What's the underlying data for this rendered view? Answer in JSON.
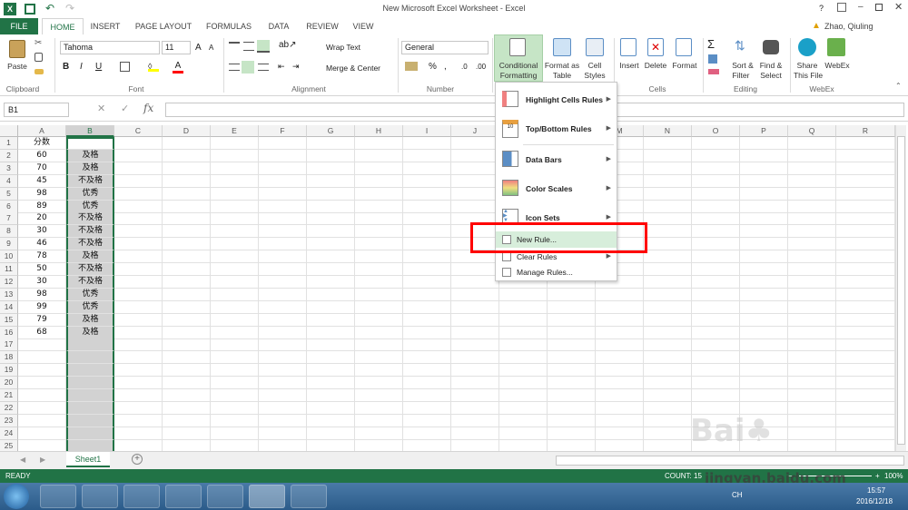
{
  "window": {
    "title": "New Microsoft Excel Worksheet - Excel",
    "user": "Zhao, Qiuling",
    "help": "?"
  },
  "tabs": [
    "FILE",
    "HOME",
    "INSERT",
    "PAGE LAYOUT",
    "FORMULAS",
    "DATA",
    "REVIEW",
    "VIEW"
  ],
  "ribbon": {
    "paste": "Paste",
    "clipboard": "Clipboard",
    "font_name": "Tahoma",
    "font_size": "11",
    "font": "Font",
    "bold": "B",
    "italic": "I",
    "underline": "U",
    "wrap_text": "Wrap Text",
    "merge_center": "Merge & Center",
    "alignment": "Alignment",
    "number_format": "General",
    "number": "Number",
    "percent": "%",
    "cond_fmt_1": "Conditional",
    "cond_fmt_2": "Formatting",
    "format_table_1": "Format as",
    "format_table_2": "Table",
    "cell_styles_1": "Cell",
    "cell_styles_2": "Styles",
    "insert": "Insert",
    "delete": "Delete",
    "format": "Format",
    "cells": "Cells",
    "sort_1": "Sort &",
    "sort_2": "Filter",
    "find_1": "Find &",
    "find_2": "Select",
    "editing": "Editing",
    "share_1": "Share",
    "share_2": "This File",
    "webex_1": "WebEx",
    "webex": "WebEx",
    "sigma": "Σ"
  },
  "formula_bar": {
    "name_box": "B1",
    "fx": "fx",
    "content": ""
  },
  "columns": [
    "A",
    "B",
    "C",
    "D",
    "E",
    "F",
    "G",
    "H",
    "I",
    "J",
    "K",
    "L",
    "M",
    "N",
    "O",
    "P",
    "Q",
    "R"
  ],
  "rows": [
    "1",
    "2",
    "3",
    "4",
    "5",
    "6",
    "7",
    "8",
    "9",
    "10",
    "11",
    "12",
    "13",
    "14",
    "15",
    "16",
    "17",
    "18",
    "19",
    "20",
    "21",
    "22",
    "23",
    "24",
    "25"
  ],
  "col_a": [
    "分数",
    "60",
    "70",
    "45",
    "98",
    "89",
    "20",
    "30",
    "46",
    "78",
    "50",
    "30",
    "98",
    "99",
    "79",
    "68"
  ],
  "col_b": [
    "",
    "及格",
    "及格",
    "不及格",
    "优秀",
    "优秀",
    "不及格",
    "不及格",
    "不及格",
    "及格",
    "不及格",
    "不及格",
    "优秀",
    "优秀",
    "及格",
    "及格"
  ],
  "menu": {
    "items": [
      "Highlight Cells Rules",
      "Top/Bottom Rules",
      "Data Bars",
      "Color Scales",
      "Icon Sets"
    ],
    "new_rule": "New Rule...",
    "clear_rules": "Clear Rules",
    "manage_rules": "Manage Rules..."
  },
  "sheet_tab": "Sheet1",
  "status": {
    "ready": "READY",
    "count": "COUNT: 15",
    "zoom": "100%"
  },
  "watermark": "jingyan.baidu.com",
  "clock": {
    "time": "15:57",
    "date": "2016/12/18",
    "lang": "CH"
  },
  "colors": {
    "excel_green": "#217346",
    "highlight": "#ff0000"
  }
}
